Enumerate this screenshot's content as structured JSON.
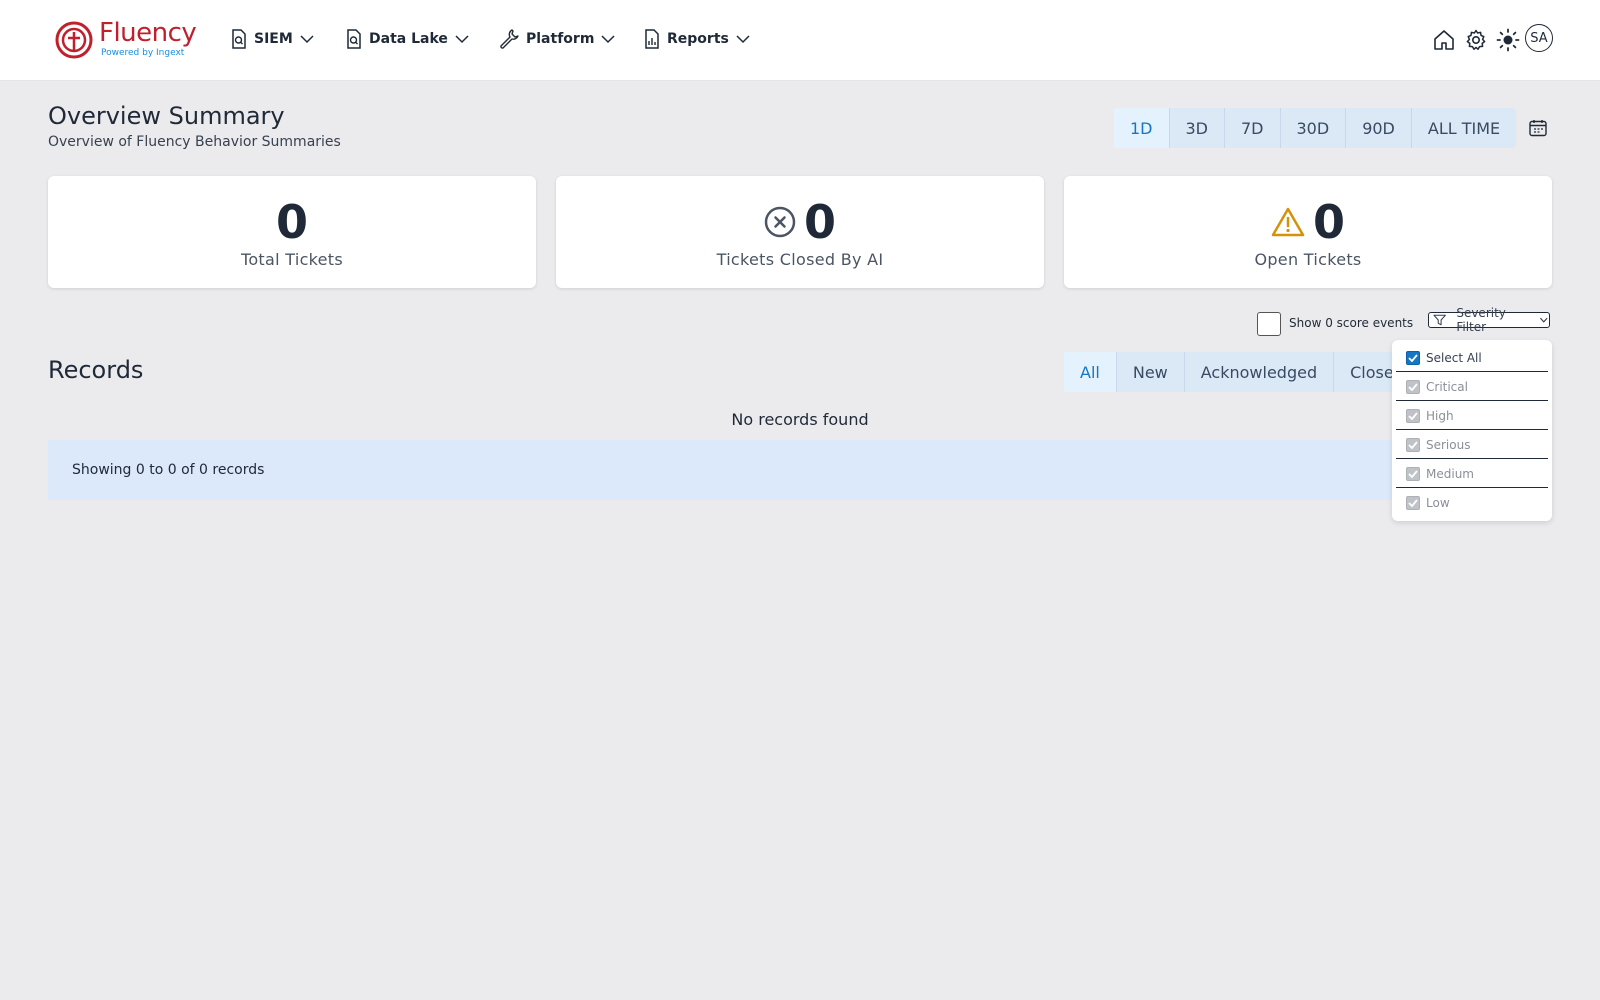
{
  "brand": {
    "name": "Fluency",
    "tagline": "Powered by Ingext"
  },
  "nav": [
    {
      "label": "SIEM"
    },
    {
      "label": "Data Lake"
    },
    {
      "label": "Platform"
    },
    {
      "label": "Reports"
    }
  ],
  "user": {
    "initials": "SA"
  },
  "header": {
    "title": "Overview Summary",
    "subtitle": "Overview of Fluency Behavior Summaries"
  },
  "time_ranges": [
    "1D",
    "3D",
    "7D",
    "30D",
    "90D",
    "ALL TIME"
  ],
  "time_range_selected": "1D",
  "stats": [
    {
      "value": "0",
      "label": "Total Tickets"
    },
    {
      "value": "0",
      "label": "Tickets Closed By AI"
    },
    {
      "value": "0",
      "label": "Open Tickets"
    }
  ],
  "filters": {
    "score_events_label": "Show 0 score events",
    "score_events_checked": false,
    "severity_button": "Severity Filter"
  },
  "severity_menu": [
    {
      "label": "Select All",
      "checked": true,
      "disabled": false
    },
    {
      "label": "Critical",
      "checked": true,
      "disabled": true
    },
    {
      "label": "High",
      "checked": true,
      "disabled": true
    },
    {
      "label": "Serious",
      "checked": true,
      "disabled": true
    },
    {
      "label": "Medium",
      "checked": true,
      "disabled": true
    },
    {
      "label": "Low",
      "checked": true,
      "disabled": true
    }
  ],
  "records": {
    "title": "Records",
    "tabs": [
      "All",
      "New",
      "Acknowledged",
      "Close"
    ],
    "active_tab": "All",
    "empty_text": "No records found",
    "showing_text": "Showing 0 to 0 of 0 records"
  },
  "colors": {
    "brand_red": "#c0202b",
    "accent_blue": "#1476c5",
    "warning": "#d4920a"
  }
}
